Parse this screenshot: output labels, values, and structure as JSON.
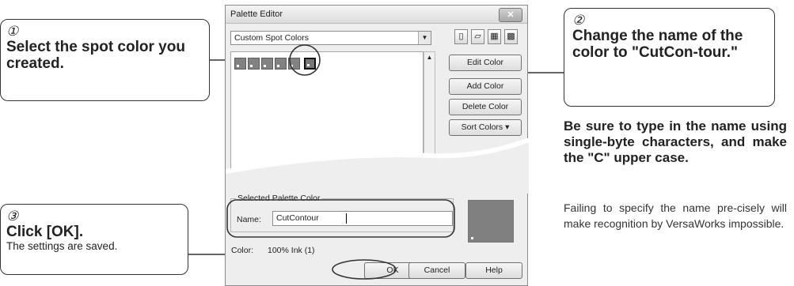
{
  "callouts": {
    "step1": {
      "number": "①",
      "title": "Select the spot color you created."
    },
    "step2": {
      "number": "②",
      "title": "Change the name of the color to \"CutCon-tour.\""
    },
    "step3": {
      "number": "③",
      "title": "Click [OK].",
      "subtitle": "The settings are saved."
    }
  },
  "notes": {
    "bold": "Be sure to type in the name using single-byte characters, and make the \"C\" upper case.",
    "plain": "Failing to specify the name pre-cisely will make recognition by VersaWorks impossible."
  },
  "dialog": {
    "title": "Palette Editor",
    "close_label": "✕",
    "palette_selector": {
      "value": "Custom Spot Colors"
    },
    "toolbar": [
      "new-palette-icon",
      "open-palette-icon",
      "save-palette-icon",
      "save-as-palette-icon"
    ],
    "swatches": {
      "count": 6,
      "selected_index": 5,
      "color": "#828282"
    },
    "buttons": {
      "edit": "Edit Color",
      "add": "Add Color",
      "delete": "Delete Color",
      "sort": "Sort Colors ▾",
      "ok": "OK",
      "cancel": "Cancel",
      "help": "Help"
    },
    "selected_group_label": "Selected Palette Color",
    "name_label": "Name:",
    "name_value": "CutContour",
    "color_label": "Color:",
    "color_value": "100%  Ink (1)",
    "preview_color": "#808080"
  }
}
